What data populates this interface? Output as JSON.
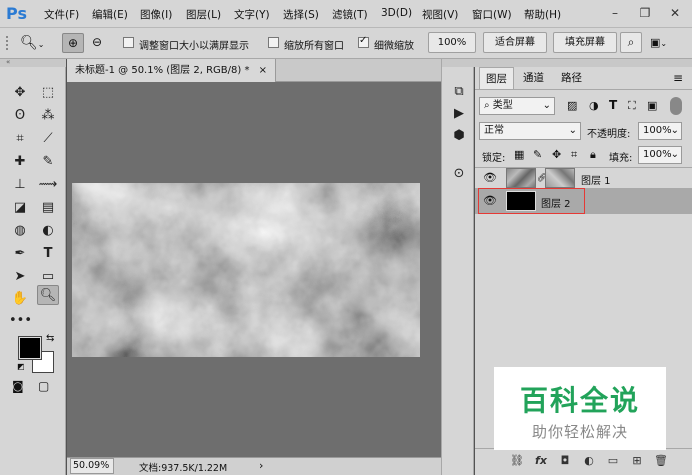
{
  "app": {
    "logo": "Ps"
  },
  "menu": [
    "文件(F)",
    "编辑(E)",
    "图像(I)",
    "图层(L)",
    "文字(Y)",
    "选择(S)",
    "滤镜(T)",
    "3D(D)",
    "视图(V)",
    "窗口(W)",
    "帮助(H)"
  ],
  "window_controls": {
    "minimize": "–",
    "restore": "❐",
    "close": "✕"
  },
  "options": {
    "resize_windows": "调整窗口大小以满屏显示",
    "zoom_all": "缩放所有窗口",
    "scrubby_zoom": "细微缩放",
    "zoom_value": "100%",
    "fit_screen": "适合屏幕",
    "fill_screen": "填充屏幕",
    "resize_windows_checked": false,
    "zoom_all_checked": false,
    "scrubby_zoom_checked": true
  },
  "document": {
    "tab_title": "未标题-1 @ 50.1% (图层 2, RGB/8) *",
    "tab_close": "×",
    "zoom": "50.09%",
    "doc_info": "文档:937.5K/1.22M",
    "status_arrow": "›"
  },
  "layers_panel": {
    "tabs": [
      "图层",
      "通道",
      "路径"
    ],
    "filter_kind": "类型",
    "blend_mode": "正常",
    "opacity_label": "不透明度:",
    "opacity_value": "100%",
    "lock_label": "锁定:",
    "fill_label": "填充:",
    "fill_value": "100%",
    "layers": [
      {
        "name": "图层 1",
        "visible": true,
        "selected": false
      },
      {
        "name": "图层 2",
        "visible": true,
        "selected": true
      }
    ]
  },
  "watermark": {
    "title": "百科全说",
    "subtitle": "助你轻松解决"
  },
  "colors": {
    "ui_bg": "#d6d6d6",
    "canvas_bg": "#6e6e6e",
    "selection_highlight": "#e53935",
    "watermark_green": "#22a35a",
    "selected_layer": "#a9a9a9"
  }
}
